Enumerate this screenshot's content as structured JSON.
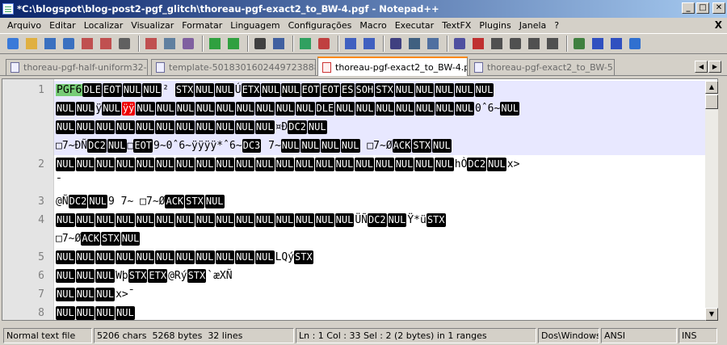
{
  "window": {
    "title": "*C:\\blogspot\\blog-post2-pgf_glitch\\thoreau-pgf-exact2_to_BW-4.pgf - Notepad++"
  },
  "menu": [
    "Arquivo",
    "Editar",
    "Localizar",
    "Visualizar",
    "Formatar",
    "Linguagem",
    "Configurações",
    "Macro",
    "Executar",
    "TextFX",
    "Plugins",
    "Janela",
    "?"
  ],
  "menu_close": "X",
  "toolbar_icons": [
    "new-file",
    "open-file",
    "save-file",
    "save-all",
    "close-file",
    "close-all",
    "print",
    "cut",
    "copy",
    "paste",
    "undo",
    "redo",
    "find",
    "replace",
    "zoom-in",
    "zoom-out",
    "sync-vertical",
    "sync-horizontal",
    "word-wrap",
    "show-all-chars",
    "indent-guide",
    "user-defined-lang",
    "start-record",
    "stop-record",
    "playback",
    "play-multiple",
    "save-macro",
    "trim",
    "move-up",
    "move-down",
    "spell"
  ],
  "tabs": [
    {
      "label": "thoreau-pgf-half-uniform32-6.pgf",
      "active": false
    },
    {
      "label": "template-5018301602449723888.xml",
      "active": false
    },
    {
      "label": "thoreau-pgf-exact2_to_BW-4.pgf",
      "active": true
    },
    {
      "label": "thoreau-pgf-exact2_to_BW-5.pgf",
      "active": false
    }
  ],
  "editor": {
    "lines": [
      {
        "n": "1",
        "segs": [
          [
            "g",
            "PGF6"
          ],
          [
            "b",
            "DLE"
          ],
          [
            "b",
            "EOT"
          ],
          [
            "b",
            "NUL"
          ],
          [
            "b",
            "NUL"
          ],
          [
            "t",
            "² "
          ],
          [
            "b",
            "STX"
          ],
          [
            "b",
            "NUL"
          ],
          [
            "b",
            "NUL"
          ],
          [
            "t",
            "Ú"
          ],
          [
            "b",
            "ETX"
          ],
          [
            "b",
            "NUL"
          ],
          [
            "b",
            "NUL"
          ],
          [
            "b",
            "EOT"
          ],
          [
            "b",
            "EOT"
          ],
          [
            "b",
            "ES"
          ],
          [
            "b",
            "SOH"
          ],
          [
            "b",
            "STX"
          ],
          [
            "b",
            "NUL"
          ],
          [
            "b",
            "NUL"
          ],
          [
            "b",
            "NUL"
          ],
          [
            "b",
            "NUL"
          ],
          [
            "b",
            "NUL"
          ]
        ]
      },
      {
        "n": "",
        "segs": [
          [
            "b",
            "NUL"
          ],
          [
            "b",
            "NUL"
          ],
          [
            "t",
            "ÿ"
          ],
          [
            "b",
            "NUL"
          ],
          [
            "r",
            "ÿÿ"
          ],
          [
            "b",
            "NUL"
          ],
          [
            "b",
            "NUL"
          ],
          [
            "b",
            "NUL"
          ],
          [
            "b",
            "NUL"
          ],
          [
            "b",
            "NUL"
          ],
          [
            "b",
            "NUL"
          ],
          [
            "b",
            "NUL"
          ],
          [
            "b",
            "NUL"
          ],
          [
            "b",
            "NUL"
          ],
          [
            "b",
            "DLE"
          ],
          [
            "b",
            "NUL"
          ],
          [
            "b",
            "NUL"
          ],
          [
            "b",
            "NUL"
          ],
          [
            "b",
            "NUL"
          ],
          [
            "b",
            "NUL"
          ],
          [
            "b",
            "NUL"
          ],
          [
            "b",
            "NUL"
          ],
          [
            "t",
            "0ˆ6~"
          ],
          [
            "b",
            "NUL"
          ]
        ]
      },
      {
        "n": "",
        "segs": [
          [
            "b",
            "NUL"
          ],
          [
            "b",
            "NUL"
          ],
          [
            "b",
            "NUL"
          ],
          [
            "b",
            "NUL"
          ],
          [
            "b",
            "NUL"
          ],
          [
            "b",
            "NUL"
          ],
          [
            "b",
            "NUL"
          ],
          [
            "b",
            "NUL"
          ],
          [
            "b",
            "NUL"
          ],
          [
            "b",
            "NUL"
          ],
          [
            "b",
            "NUL"
          ],
          [
            "t",
            "¤Ð"
          ],
          [
            "b",
            "DC2"
          ],
          [
            "b",
            "NUL"
          ]
        ]
      },
      {
        "n": "",
        "segs": [
          [
            "t",
            "□7~ÐÑ"
          ],
          [
            "b",
            "DC2"
          ],
          [
            "b",
            "NUL"
          ],
          [
            "t",
            "□"
          ],
          [
            "b",
            "EOT"
          ],
          [
            "t",
            "9~0ˆ6~ÿÿÿÿ*ˆ6~"
          ],
          [
            "b",
            "DC3"
          ],
          [
            "t",
            " 7~"
          ],
          [
            "b",
            "NUL"
          ],
          [
            "b",
            "NUL"
          ],
          [
            "b",
            "NUL"
          ],
          [
            "b",
            "NUL"
          ],
          [
            "t",
            " □7~Ø"
          ],
          [
            "b",
            "ACK"
          ],
          [
            "b",
            "STX"
          ],
          [
            "b",
            "NUL"
          ]
        ]
      },
      {
        "n": "2",
        "segs": [
          [
            "b",
            "NUL"
          ],
          [
            "b",
            "NUL"
          ],
          [
            "b",
            "NUL"
          ],
          [
            "b",
            "NUL"
          ],
          [
            "b",
            "NUL"
          ],
          [
            "b",
            "NUL"
          ],
          [
            "b",
            "NUL"
          ],
          [
            "b",
            "NUL"
          ],
          [
            "b",
            "NUL"
          ],
          [
            "b",
            "NUL"
          ],
          [
            "b",
            "NUL"
          ],
          [
            "b",
            "NUL"
          ],
          [
            "b",
            "NUL"
          ],
          [
            "b",
            "NUL"
          ],
          [
            "b",
            "NUL"
          ],
          [
            "b",
            "NUL"
          ],
          [
            "b",
            "NUL"
          ],
          [
            "b",
            "NUL"
          ],
          [
            "b",
            "NUL"
          ],
          [
            "b",
            "NUL"
          ],
          [
            "t",
            "hÒ"
          ],
          [
            "b",
            "DC2"
          ],
          [
            "b",
            "NUL"
          ],
          [
            "t",
            "x>"
          ]
        ]
      },
      {
        "n": "",
        "segs": [
          [
            "t",
            "¯"
          ]
        ]
      },
      {
        "n": "3",
        "segs": [
          [
            "t",
            "@Ñ"
          ],
          [
            "b",
            "DC2"
          ],
          [
            "b",
            "NUL"
          ],
          [
            "t",
            "9 7~ □7~Ø"
          ],
          [
            "b",
            "ACK"
          ],
          [
            "b",
            "STX"
          ],
          [
            "b",
            "NUL"
          ]
        ]
      },
      {
        "n": "4",
        "segs": [
          [
            "b",
            "NUL"
          ],
          [
            "b",
            "NUL"
          ],
          [
            "b",
            "NUL"
          ],
          [
            "b",
            "NUL"
          ],
          [
            "b",
            "NUL"
          ],
          [
            "b",
            "NUL"
          ],
          [
            "b",
            "NUL"
          ],
          [
            "b",
            "NUL"
          ],
          [
            "b",
            "NUL"
          ],
          [
            "b",
            "NUL"
          ],
          [
            "b",
            "NUL"
          ],
          [
            "b",
            "NUL"
          ],
          [
            "b",
            "NUL"
          ],
          [
            "b",
            "NUL"
          ],
          [
            "b",
            "NUL"
          ],
          [
            "t",
            "ÜÑ"
          ],
          [
            "b",
            "DC2"
          ],
          [
            "b",
            "NUL"
          ],
          [
            "t",
            "Ÿ*ü"
          ],
          [
            "b",
            "STX"
          ]
        ]
      },
      {
        "n": "",
        "segs": [
          [
            "t",
            "□7~Ø"
          ],
          [
            "b",
            "ACK"
          ],
          [
            "b",
            "STX"
          ],
          [
            "b",
            "NUL"
          ]
        ]
      },
      {
        "n": "5",
        "segs": [
          [
            "b",
            "NUL"
          ],
          [
            "b",
            "NUL"
          ],
          [
            "b",
            "NUL"
          ],
          [
            "b",
            "NUL"
          ],
          [
            "b",
            "NUL"
          ],
          [
            "b",
            "NUL"
          ],
          [
            "b",
            "NUL"
          ],
          [
            "b",
            "NUL"
          ],
          [
            "b",
            "NUL"
          ],
          [
            "b",
            "NUL"
          ],
          [
            "b",
            "NUL"
          ],
          [
            "t",
            "LQý"
          ],
          [
            "b",
            "STX"
          ]
        ]
      },
      {
        "n": "6",
        "segs": [
          [
            "b",
            "NUL"
          ],
          [
            "b",
            "NUL"
          ],
          [
            "b",
            "NUL"
          ],
          [
            "t",
            "Wþ"
          ],
          [
            "b",
            "STX"
          ],
          [
            "b",
            "ETX"
          ],
          [
            "t",
            "@Rý"
          ],
          [
            "b",
            "STX"
          ],
          [
            "t",
            "`æXÑ"
          ]
        ]
      },
      {
        "n": "7",
        "segs": [
          [
            "b",
            "NUL"
          ],
          [
            "b",
            "NUL"
          ],
          [
            "b",
            "NUL"
          ],
          [
            "t",
            "x>¯"
          ]
        ]
      },
      {
        "n": "8",
        "segs": [
          [
            "b",
            "NUL"
          ],
          [
            "b",
            "NUL"
          ],
          [
            "b",
            "NUL"
          ],
          [
            "b",
            "NUL"
          ]
        ]
      }
    ]
  },
  "status": {
    "file_type": "Normal text file",
    "chars": "5206 chars",
    "bytes": "5268 bytes",
    "lines": "32 lines",
    "position": "Ln : 1    Col : 33    Sel : 2 (2 bytes) in 1 ranges",
    "eol": "Dos\\Windows",
    "encoding": "ANSI",
    "mode": "INS"
  },
  "colors": {
    "selection": "#e8e8ff",
    "null_box": "#000000",
    "red_box": "#e00000",
    "green_hl": "#77cc77"
  }
}
